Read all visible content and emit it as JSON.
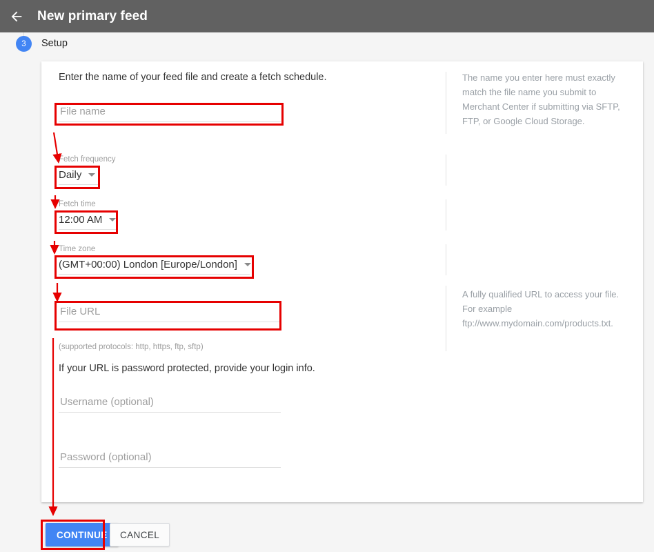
{
  "appbar": {
    "back_icon": "arrow-left-icon",
    "title": "New primary feed"
  },
  "step": {
    "number": "3",
    "title": "Setup"
  },
  "card": {
    "intro": "Enter the name of your feed file and create a fetch schedule.",
    "fields": {
      "file_name": {
        "placeholder": "File name",
        "value": ""
      },
      "fetch_frequency": {
        "label": "Fetch frequency",
        "value": "Daily"
      },
      "fetch_time": {
        "label": "Fetch time",
        "value": "12:00 AM"
      },
      "time_zone": {
        "label": "Time zone",
        "value": "(GMT+00:00) London [Europe/London]"
      },
      "file_url": {
        "placeholder": "File URL",
        "value": ""
      },
      "username": {
        "placeholder": "Username (optional)",
        "value": ""
      },
      "password": {
        "placeholder": "Password (optional)",
        "value": ""
      }
    },
    "notes": {
      "protocols": "(supported protocols: http, https, ftp, sftp)",
      "login_info": "If your URL is password protected, provide your login info."
    },
    "help": {
      "file_name": "The name you enter here must exactly match the file name you submit to Merchant Center if submitting via SFTP, FTP, or Google Cloud Storage.",
      "file_url": "A fully qualified URL to access your file. For example ftp://www.mydomain.com/products.txt."
    }
  },
  "actions": {
    "continue_label": "CONTINUE",
    "cancel_label": "CANCEL"
  },
  "colors": {
    "appbar": "#616161",
    "accent": "#4285f4",
    "annotation": "#e60000",
    "page_background": "#f5f5f5",
    "card_background": "#ffffff",
    "placeholder_text": "#9e9e9e",
    "help_text": "#9aa0a6"
  }
}
